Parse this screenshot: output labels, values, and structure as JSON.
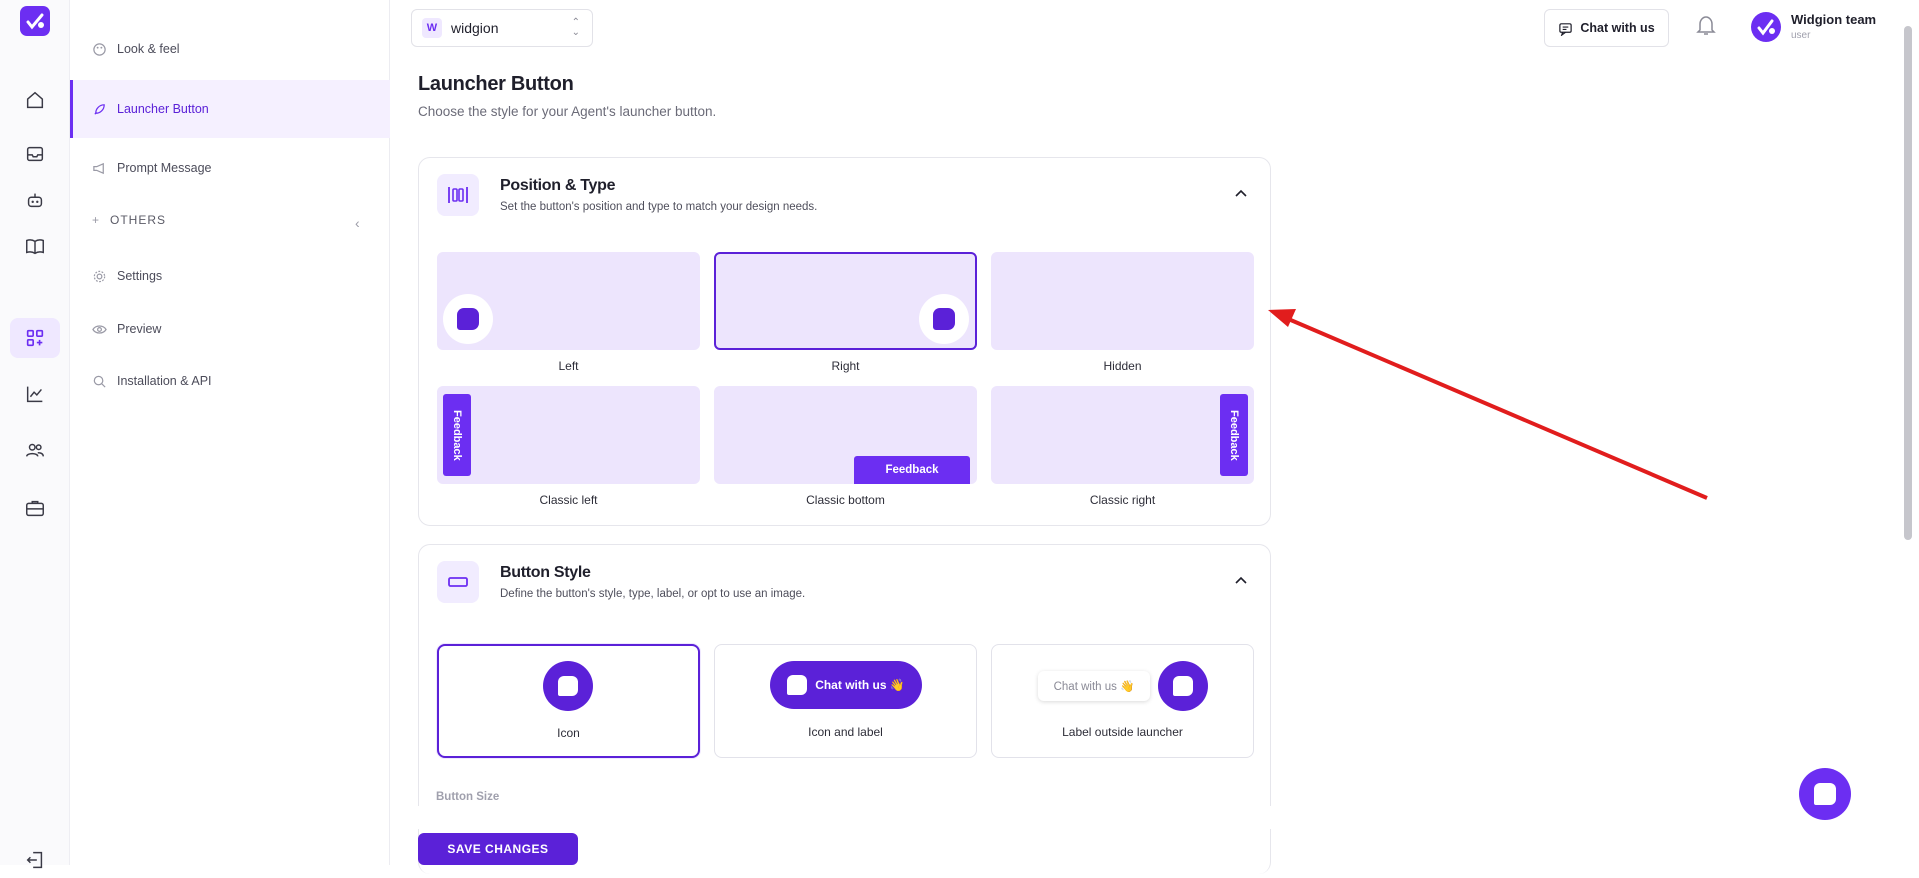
{
  "workspace": {
    "badge": "W",
    "name": "widgion"
  },
  "topbar": {
    "chat_label": "Chat with us",
    "user_name": "Widgion team",
    "user_role": "user"
  },
  "sidebar": {
    "items": [
      {
        "label": "Look & feel",
        "icon": "palette-icon"
      },
      {
        "label": "Launcher Button",
        "icon": "rocket-icon"
      },
      {
        "label": "Prompt Message",
        "icon": "megaphone-icon"
      },
      {
        "label": "Settings",
        "icon": "gear-icon"
      },
      {
        "label": "Preview",
        "icon": "eye-icon"
      },
      {
        "label": "Installation & API",
        "icon": "code-search-icon"
      }
    ],
    "others_label": "OTHERS"
  },
  "main": {
    "title": "Launcher Button",
    "subtitle": "Choose the style for your Agent's launcher button.",
    "position_card": {
      "title": "Position & Type",
      "description": "Set the button's position and type to match your design needs.",
      "options": [
        "Left",
        "Right",
        "Hidden",
        "Classic left",
        "Classic bottom",
        "Classic right"
      ],
      "selected": "Right",
      "tab_label": "Feedback"
    },
    "style_card": {
      "title": "Button Style",
      "description": "Define the button's style, type, label, or opt to use an image.",
      "options": [
        "Icon",
        "Icon and label",
        "Label outside launcher"
      ],
      "selected": "Icon",
      "pill_label": "Chat with us 👋",
      "outside_label": "Chat with us 👋",
      "size_label": "Button Size"
    },
    "save_label": "SAVE CHANGES"
  },
  "colors": {
    "accent": "#5b21d8",
    "accent_light": "#ede5fd",
    "arrow": "#e11d1d"
  }
}
